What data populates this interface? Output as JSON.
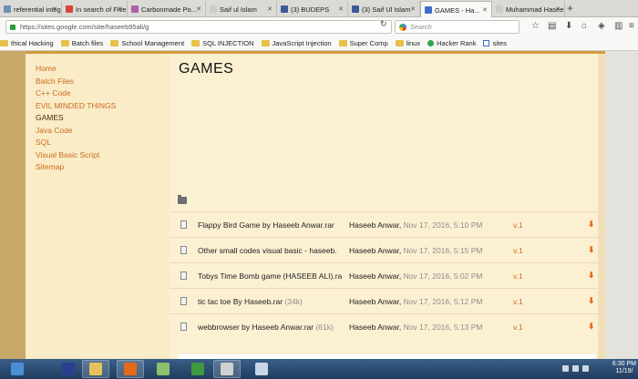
{
  "browser": {
    "tabs": [
      {
        "label": "referential integ...",
        "favicon_color": "#6b8fb8"
      },
      {
        "label": "In search of Five...",
        "favicon_color": "#d44638"
      },
      {
        "label": "Carbonmade Po...",
        "favicon_color": "#b05fa8"
      },
      {
        "label": "Saif ul Islam",
        "favicon_color": "#cccccc"
      },
      {
        "label": "(3) BUDEPS",
        "favicon_color": "#3b5998"
      },
      {
        "label": "(3) Saif Ul Islam",
        "favicon_color": "#3b5998"
      },
      {
        "label": "GAMES - Ha...",
        "favicon_color": "#3c6ecb"
      },
      {
        "label": "Muhammad Haseeb...",
        "favicon_color": "#cccccc"
      }
    ],
    "url": "https://sites.google.com/site/haseeb95ali/g",
    "search_placeholder": "Search",
    "bookmarks": [
      {
        "label": "thical Hacking",
        "icon": "folder"
      },
      {
        "label": "Batch files",
        "icon": "folder"
      },
      {
        "label": "School Management",
        "icon": "folder"
      },
      {
        "label": "SQL INJECTION",
        "icon": "folder"
      },
      {
        "label": "JavaScript Injection",
        "icon": "folder"
      },
      {
        "label": "Super Comp",
        "icon": "folder"
      },
      {
        "label": "linux",
        "icon": "folder"
      },
      {
        "label": "Hacker Rank",
        "icon": "hackerrank"
      },
      {
        "label": "sites",
        "icon": "google-sites"
      }
    ]
  },
  "site": {
    "nav": [
      {
        "label": "Home",
        "current": false
      },
      {
        "label": "Batch Files",
        "current": false
      },
      {
        "label": "C++ Code",
        "current": false
      },
      {
        "label": "EVIL MINDED THINGS",
        "current": false
      },
      {
        "label": "GAMES",
        "current": true
      },
      {
        "label": "Java Code",
        "current": false
      },
      {
        "label": "SQL",
        "current": false
      },
      {
        "label": "Visual Basic Script",
        "current": false
      },
      {
        "label": "Sitemap",
        "current": false
      }
    ],
    "page_title": "GAMES",
    "files": [
      {
        "name": "Flappy Bird Game by Haseeb Anwar.rar",
        "size": "",
        "user": "Haseeb Anwar,",
        "date": "Nov 17, 2016, 5:10 PM",
        "version": "v.1"
      },
      {
        "name": "Other small codes visual basic - haseeb.",
        "size": "",
        "user": "Haseeb Anwar,",
        "date": "Nov 17, 2016, 5:15 PM",
        "version": "v.1"
      },
      {
        "name": "Tobys Time Bomb game (HASEEB ALI).ra",
        "size": "",
        "user": "Haseeb Anwar,",
        "date": "Nov 17, 2016, 5:02 PM",
        "version": "v.1"
      },
      {
        "name": "tic tac toe By Haseeb.rar",
        "size": "(34k)",
        "user": "Haseeb Anwar,",
        "date": "Nov 17, 2016, 5:12 PM",
        "version": "v.1"
      },
      {
        "name": "webbrowser by Haseeb Anwar.rar",
        "size": "(61k)",
        "user": "Haseeb Anwar,",
        "date": "Nov 17, 2016, 5:13 PM",
        "version": "v.1"
      }
    ],
    "download_glyph": "⬇"
  },
  "taskbar": {
    "apps": [
      {
        "name": "ie-icon",
        "color": "#4a8fd6"
      },
      {
        "name": "devcpp-icon",
        "color": "#2a3f8f"
      },
      {
        "name": "file-explorer-icon",
        "color": "#e6c35a"
      },
      {
        "name": "firefox-icon",
        "color": "#e66a1c"
      },
      {
        "name": "folder-icon",
        "color": "#8fbf6a"
      },
      {
        "name": "utorrent-icon",
        "color": "#3f9a3f"
      },
      {
        "name": "java-icon",
        "color": "#d0d0d0"
      },
      {
        "name": "paint-icon",
        "color": "#c9d6e8"
      }
    ],
    "time": "6:30 PM",
    "date": "11/19/"
  }
}
